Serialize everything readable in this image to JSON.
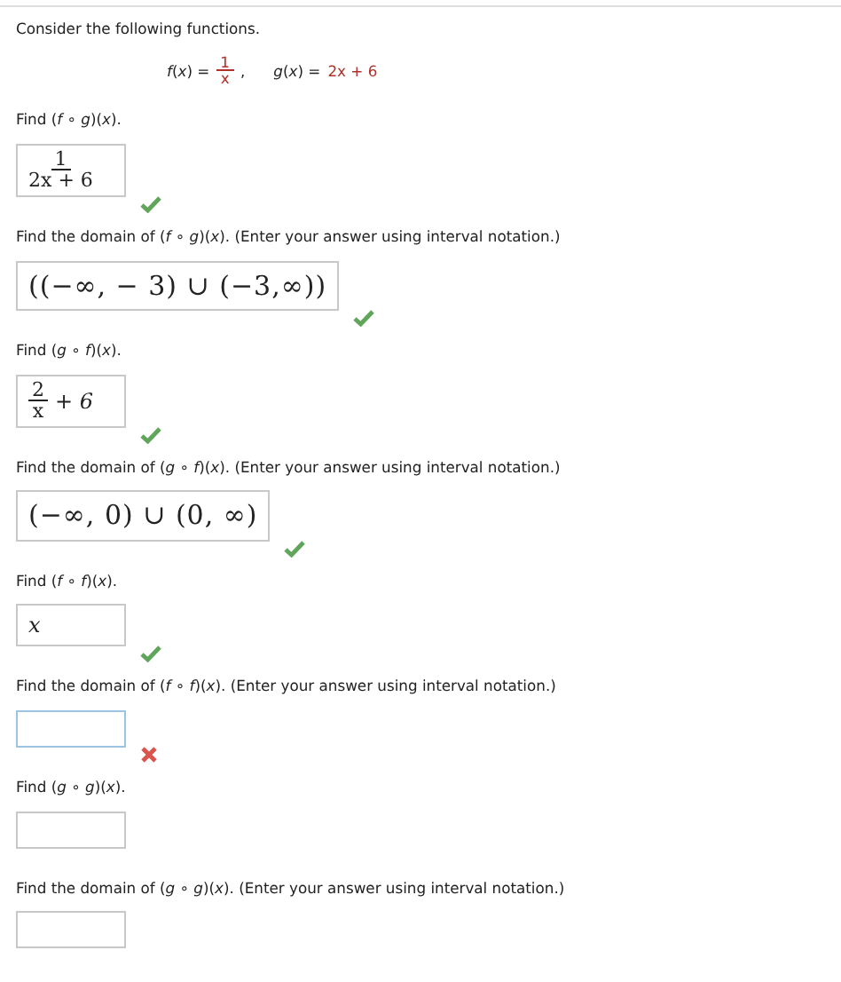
{
  "intro": "Consider the following functions.",
  "functions": [
    {
      "lhs": "*f*(*x*) =",
      "rhs": {
        "kind": "fraction",
        "numerator": "1",
        "denominator": "x"
      },
      "separator": ","
    },
    {
      "lhs": "*g*(*x*) =",
      "rhs": {
        "kind": "text",
        "text": "2x + 6"
      }
    }
  ],
  "questions": [
    {
      "prompt": "Find  (*f* ∘ *g*)(*x*).",
      "answer": [
        {
          "kind": "fraction",
          "numerator": "1",
          "denominator": "2x + 6"
        }
      ],
      "graded": true,
      "correct": true,
      "focused": false
    },
    {
      "prompt": "Find the domain of  (*f* ∘ *g*)(*x*).  (Enter your answer using interval notation.)",
      "answer": [
        {
          "kind": "interval",
          "text": "((−∞, − 3) ∪ (−3,∞))"
        }
      ],
      "graded": true,
      "correct": true,
      "focused": false
    },
    {
      "prompt": "Find  (*g* ∘ *f*)(*x*).",
      "answer": [
        {
          "kind": "fraction",
          "numerator": "2",
          "denominator": "x"
        },
        {
          "kind": "text",
          "text": "+ 6"
        }
      ],
      "graded": true,
      "correct": true,
      "focused": false
    },
    {
      "prompt": "Find the domain of  (*g* ∘ *f*)(*x*).  (Enter your answer using interval notation.)",
      "answer": [
        {
          "kind": "interval",
          "text": "(−∞, 0) ∪ (0, ∞)"
        }
      ],
      "graded": true,
      "correct": true,
      "focused": false
    },
    {
      "prompt": "Find  (*f* ∘ *f*)(*x*).",
      "answer": [
        {
          "kind": "text",
          "text": "x"
        }
      ],
      "graded": true,
      "correct": true,
      "focused": false
    },
    {
      "prompt": "Find the domain of  (*f* ∘ *f*)(*x*).  (Enter your answer using interval notation.)",
      "graded": true,
      "correct": false,
      "focused": true
    },
    {
      "prompt": "Find  (*g* ∘ *g*)(*x*).",
      "graded": false,
      "focused": false
    },
    {
      "prompt": "Find the domain of  (*g* ∘ *g*)(*x*).  (Enter your answer using interval notation.)",
      "graded": false,
      "focused": false
    }
  ]
}
